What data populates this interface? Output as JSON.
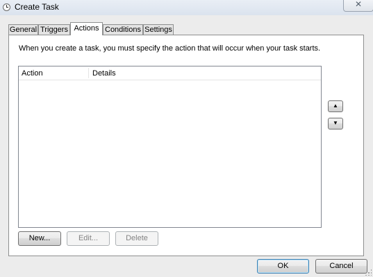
{
  "window": {
    "title": "Create Task",
    "close_label": "✕"
  },
  "tabs": [
    "General",
    "Triggers",
    "Actions",
    "Conditions",
    "Settings"
  ],
  "active_tab": "Actions",
  "actions_tab": {
    "description": "When you create a task, you must specify the action that will occur when your task starts.",
    "columns": [
      "Action",
      "Details"
    ],
    "rows": [],
    "move_up_label": "▲",
    "move_down_label": "▼",
    "new_label": "New...",
    "edit_label": "Edit...",
    "delete_label": "Delete"
  },
  "footer": {
    "ok_label": "OK",
    "cancel_label": "Cancel"
  },
  "colors": {
    "titlebar": "#dbe3ee",
    "dialog_bg": "#ececec",
    "panel_bg": "#ffffff"
  }
}
